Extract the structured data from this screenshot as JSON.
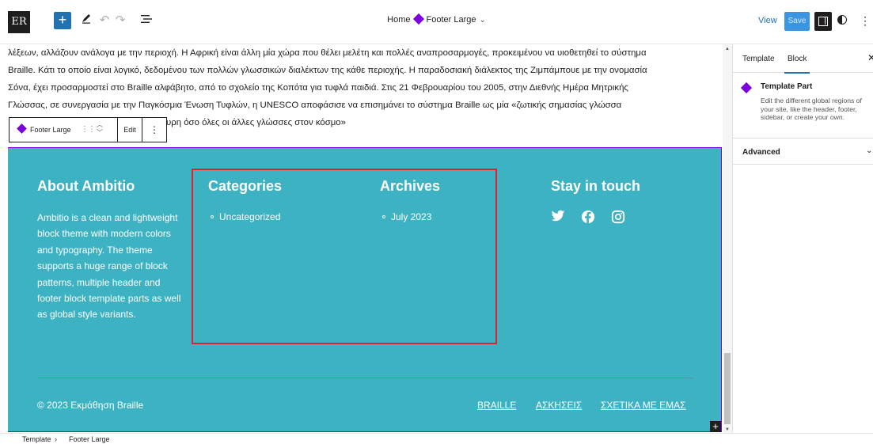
{
  "toolbar": {
    "logo": "ER",
    "title_prefix": "Home",
    "title_current": "Footer Large",
    "view_label": "View",
    "save_label": "Save"
  },
  "canvas": {
    "paragraph_lines": [
      "λέξεων, αλλάζουν ανάλογα με την περιοχή. Η Αφρική είναι άλλη μία χώρα που θέλει μελέτη και πολλές αναπροσαρμογές, προκειμένου να υιοθετηθεί το σύστημα",
      "Braille. Κάτι το οποίο είναι λογικό, δεδομένου των πολλών γλωσσικών διαλέκτων της κάθε περιοχής. Η παραδοσιακή διάλεκτος της Ζιμπάμπουε με την ονομασία",
      "Σόνα, έχει προσαρμοστεί στο Braille αλφάβητο, από το σχολείο της Κοπότα για τυφλά παιδιά. Στις 21 Φεβρουαρίου του 2005, στην Διεθνής Ημέρα Μητρικής",
      "Γλώσσας, σε συνεργασία με την Παγκόσμια Ένωση Τυφλών, η UNESCO αποφάσισε να επισημάνει το σύστημα Braille ως μία «ζωτικής σημασίας γλώσσα",
      "υρη όσο όλες οι άλλες γλώσσες στον κόσμο»"
    ],
    "block_toolbar": {
      "block_name": "Footer Large",
      "edit_label": "Edit",
      "more_label": "⋮"
    }
  },
  "footer": {
    "about": {
      "heading": "About Ambitio",
      "text": "Ambitio is a clean and lightweight block theme with modern colors and typography. The theme supports a huge range of block patterns, multiple header and footer block template parts as well as global style variants."
    },
    "categories": {
      "heading": "Categories",
      "items": [
        "Uncategorized"
      ]
    },
    "archives": {
      "heading": "Archives",
      "items": [
        "July 2023"
      ]
    },
    "stay": {
      "heading": "Stay in touch",
      "icons": [
        "twitter-icon",
        "facebook-icon",
        "instagram-icon"
      ]
    },
    "copyright": "© 2023 Εκμάθηση Braille",
    "links": [
      "BRAILLE",
      "ΑΣΚΗΣΕΙΣ",
      "ΣΧΕΤΙΚΑ ΜΕ ΕΜΑΣ"
    ],
    "highlight_color": "#d9232d",
    "background_color": "#3db2c3"
  },
  "sidebar": {
    "tabs": [
      "Template",
      "Block"
    ],
    "active_tab": "Block",
    "block_title": "Template Part",
    "block_description": "Edit the different global regions of your site, like the header, footer, sidebar, or create your own.",
    "advanced_label": "Advanced"
  },
  "statusbar": {
    "breadcrumb": [
      "Template",
      "Footer Large"
    ]
  },
  "colors": {
    "accent": "#2271b1",
    "template_part": "#7a00df"
  }
}
